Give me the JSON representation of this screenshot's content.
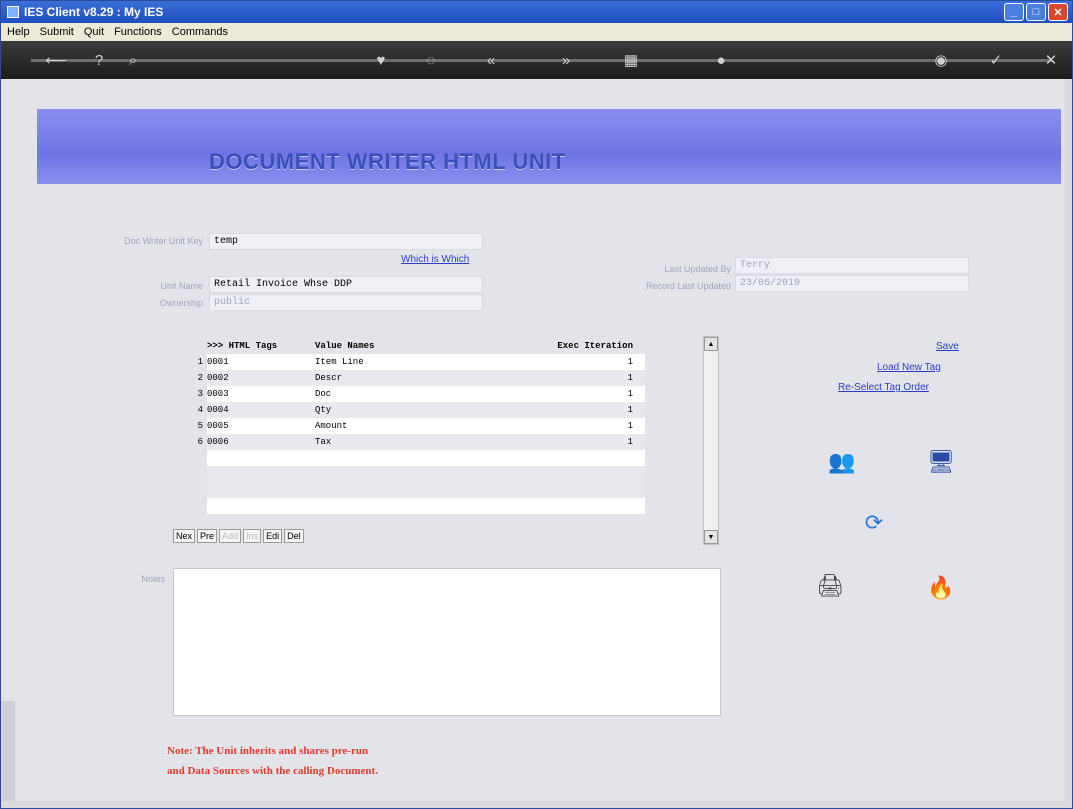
{
  "window": {
    "title": "IES Client v8.29 : My IES",
    "controls": [
      "minimize",
      "maximize",
      "close"
    ]
  },
  "menu": [
    "Help",
    "Submit",
    "Quit",
    "Functions",
    "Commands"
  ],
  "header": {
    "title": "DOCUMENT WRITER HTML UNIT"
  },
  "form": {
    "doc_writer_unit_label": "Doc Writer Unit Key",
    "doc_writer_unit_value": "temp",
    "which_link": "Which is Which",
    "unit_name_label": "Unit Name",
    "unit_name_value": "Retail Invoice Whse DDP",
    "ownership_label": "Ownership",
    "ownership_value": "public",
    "last_updated_by_label": "Last Updated By",
    "last_updated_by_value": "Terry",
    "record_last_updated_label": "Record Last Updated",
    "record_last_updated_value": "23/06/2010"
  },
  "grid": {
    "headers": [
      ">>> HTML Tags",
      "Value Names",
      "Exec Iteration"
    ],
    "rows": [
      {
        "n": "1",
        "tag": "0001",
        "val": "Item Line",
        "it": "1"
      },
      {
        "n": "2",
        "tag": "0002",
        "val": "Descr",
        "it": "1"
      },
      {
        "n": "3",
        "tag": "0003",
        "val": "Doc",
        "it": "1"
      },
      {
        "n": "4",
        "tag": "0004",
        "val": "Qty",
        "it": "1"
      },
      {
        "n": "5",
        "tag": "0005",
        "val": "Amount",
        "it": "1"
      },
      {
        "n": "6",
        "tag": "0006",
        "val": "Tax",
        "it": "1"
      }
    ],
    "nav": [
      {
        "label": "Nex",
        "dim": false
      },
      {
        "label": "Pre",
        "dim": false
      },
      {
        "label": "Add",
        "dim": true
      },
      {
        "label": "Ins",
        "dim": true
      },
      {
        "label": "Edi",
        "dim": false
      },
      {
        "label": "Del",
        "dim": false
      }
    ]
  },
  "actions": {
    "save": "Save",
    "load_new_tag": "Load New Tag",
    "reselect": "Re-Select Tag Order"
  },
  "notes_label": "Notes",
  "footer_note": {
    "line1": "Note: The Unit inherits and shares pre-run",
    "line2": "and Data Sources with the calling Document."
  }
}
